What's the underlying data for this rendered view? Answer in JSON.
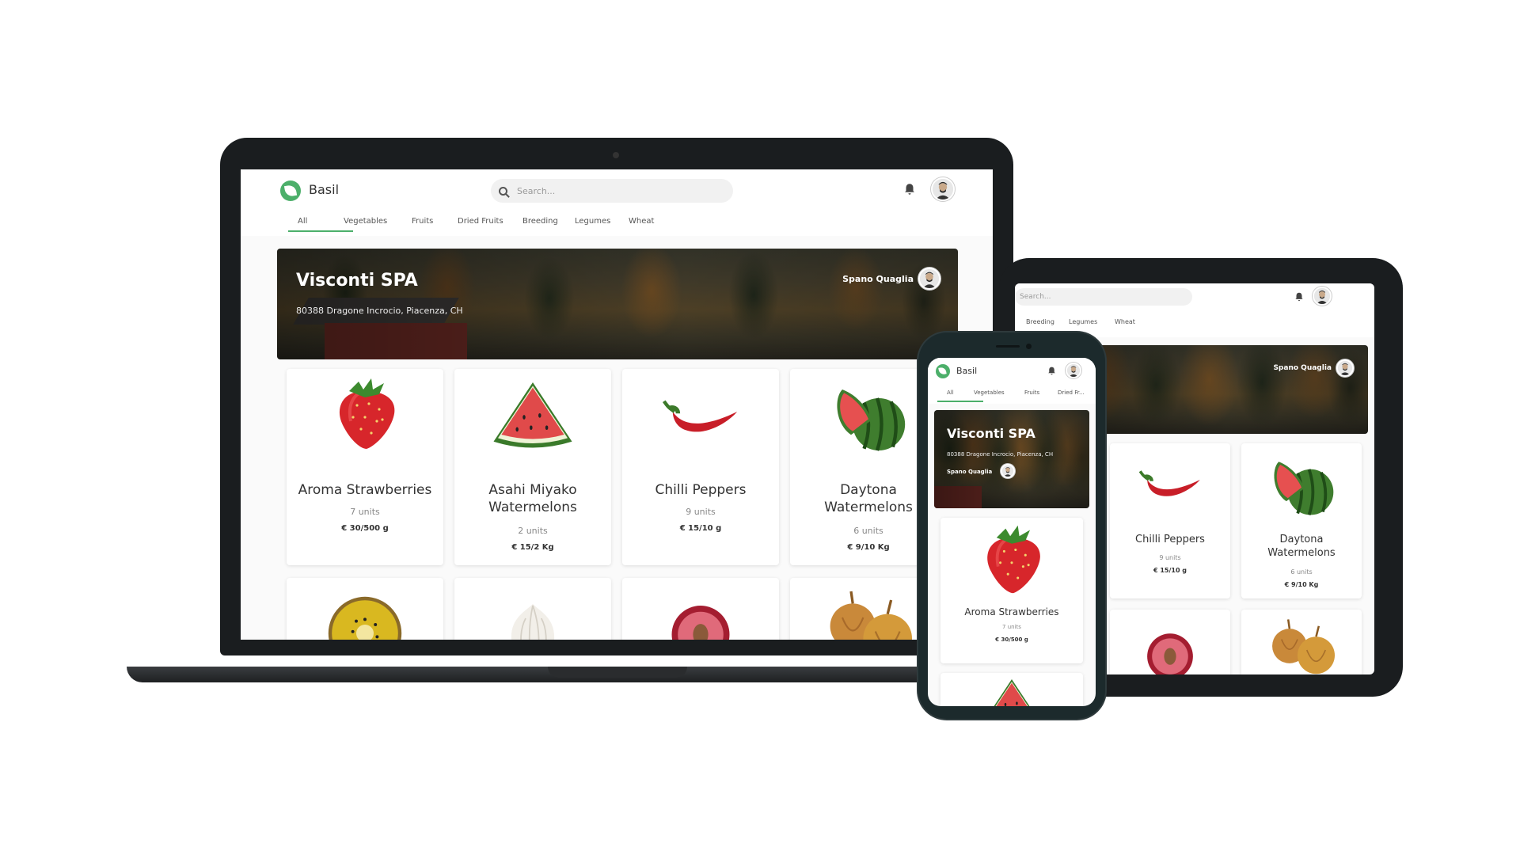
{
  "app": {
    "brand": "Basil",
    "search_placeholder": "Search...",
    "tabs": [
      "All",
      "Vegetables",
      "Fruits",
      "Dried Fruits",
      "Breeding",
      "Legumes",
      "Wheat"
    ],
    "active_tab": "All",
    "accent_color": "#4caf6a"
  },
  "farm": {
    "name": "Visconti SPA",
    "address": "80388 Dragone Incrocio, Piacenza, CH",
    "owner": "Spano Quaglia"
  },
  "products": [
    {
      "name": "Aroma Strawberries",
      "units": "7 units",
      "price": "€ 30/500 g",
      "icon": "strawberry-icon"
    },
    {
      "name": "Asahi Miyako Watermelons",
      "units": "2 units",
      "price": "€ 15/2 Kg",
      "icon": "watermelon-slice-icon"
    },
    {
      "name": "Chilli Peppers",
      "units": "9 units",
      "price": "€ 15/10 g",
      "icon": "chilli-pepper-icon"
    },
    {
      "name": "Daytona Watermelons",
      "units": "6 units",
      "price": "€ 9/10 Kg",
      "icon": "watermelon-icon"
    },
    {
      "name": "",
      "units": "",
      "price": "",
      "icon": "kiwi-icon"
    },
    {
      "name": "",
      "units": "",
      "price": "",
      "icon": "garlic-icon"
    },
    {
      "name": "",
      "units": "",
      "price": "",
      "icon": "plum-icon"
    },
    {
      "name": "",
      "units": "",
      "price": "",
      "icon": "onion-icon"
    }
  ],
  "tablet": {
    "search_placeholder": "Search...",
    "tabs": [
      "Breeding",
      "Legumes",
      "Wheat"
    ]
  },
  "phone": {
    "tabs": [
      "All",
      "Vegetables",
      "Fruits",
      "Dried Fr..."
    ]
  }
}
